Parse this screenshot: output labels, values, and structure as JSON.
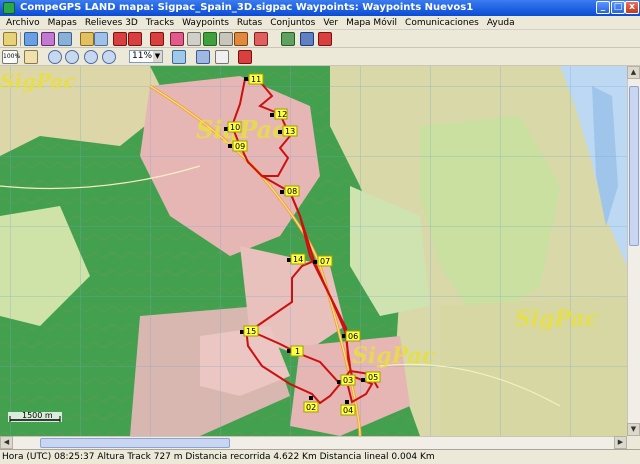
{
  "window": {
    "title": "CompeGPS LAND mapa: Sigpac_Spain_3D.sigpac Waypoints:  Waypoints Nuevos1",
    "min_label": "_",
    "max_label": "□",
    "close_label": "x"
  },
  "menu": [
    "Archivo",
    "Mapas",
    "Relieves 3D",
    "Tracks",
    "Waypoints",
    "Rutas",
    "Conjuntos",
    "Ver",
    "Mapa Móvil",
    "Comunicaciones",
    "Ayuda"
  ],
  "toolbar2": {
    "zoom100": "100%",
    "zoom_value": "11%"
  },
  "map": {
    "watermark": "SigPac",
    "scale_label": "1500 m",
    "waypoints": [
      {
        "id": "11"
      },
      {
        "id": "12"
      },
      {
        "id": "13"
      },
      {
        "id": "10"
      },
      {
        "id": "09"
      },
      {
        "id": "08"
      },
      {
        "id": "14"
      },
      {
        "id": "07"
      },
      {
        "id": "15"
      },
      {
        "id": "1"
      },
      {
        "id": "06"
      },
      {
        "id": "03"
      },
      {
        "id": "05"
      },
      {
        "id": "02"
      },
      {
        "id": "04"
      }
    ]
  },
  "statusbar": {
    "text": "Hora (UTC) 08:25:37 Altura Track 727 m Distancia recorrida 4.622 Km Distancia lineal 0.004 Km"
  }
}
